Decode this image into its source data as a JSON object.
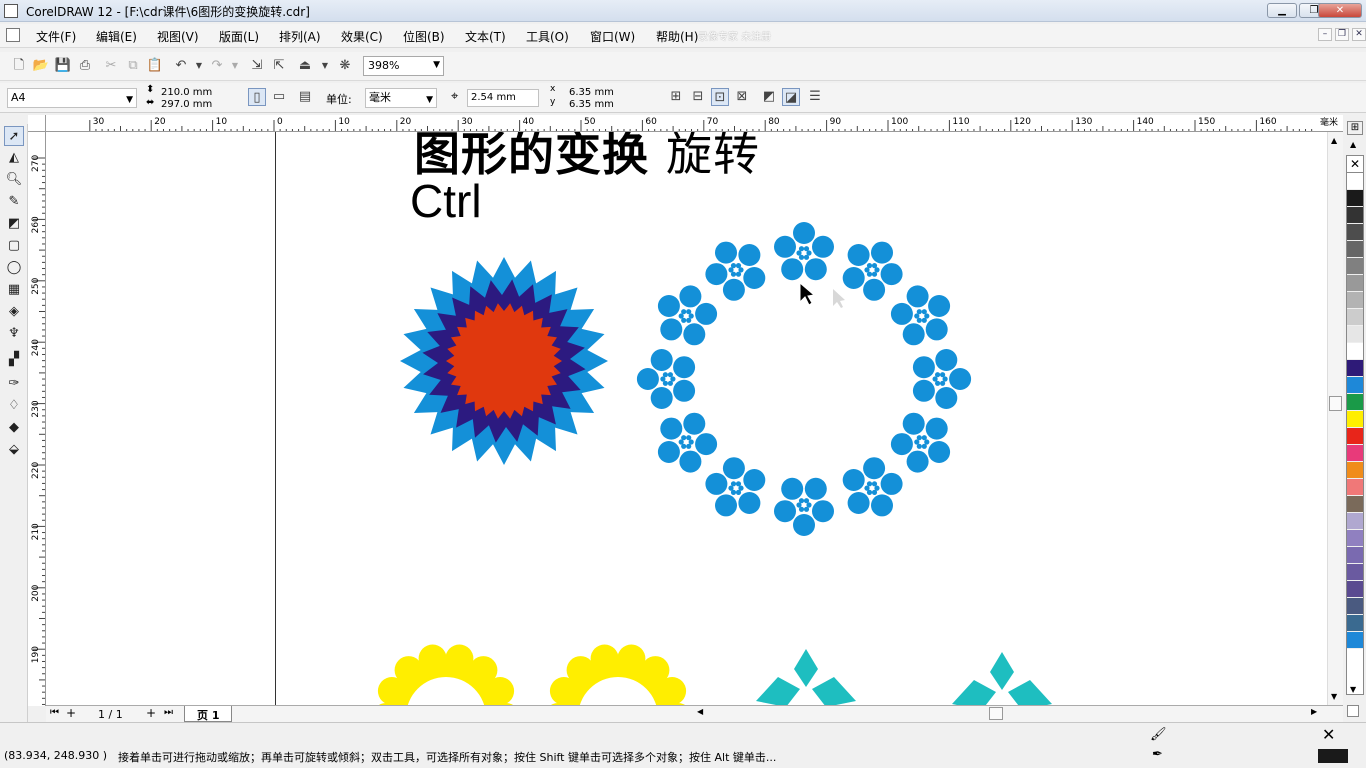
{
  "window": {
    "title": "CorelDRAW 12 - [F:\\cdr课件\\6图形的变换旋转.cdr]",
    "min": "▁",
    "max": "❐",
    "close": "✕"
  },
  "menu": {
    "items": [
      "文件(F)",
      "编辑(E)",
      "视图(V)",
      "版面(L)",
      "排列(A)",
      "效果(C)",
      "位图(B)",
      "文本(T)",
      "工具(O)",
      "窗口(W)",
      "帮助(H)"
    ],
    "overlay": "录像专家 未注册",
    "mdi": [
      "–",
      "❐",
      "✕"
    ]
  },
  "toolbar": {
    "zoom": "398%",
    "dd": "▼"
  },
  "property_bar": {
    "page_size": "A4",
    "width": "210.0 mm",
    "height": "297.0 mm",
    "unit_label": "单位:",
    "unit": "毫米",
    "nudge": "2.54 mm",
    "dup_x_label": "x",
    "dup_y_label": "y",
    "dup_x": "6.35 mm",
    "dup_y": "6.35 mm"
  },
  "ruler": {
    "h_ticks": [
      "30",
      "20",
      "10",
      "0",
      "10",
      "20",
      "30",
      "40",
      "50",
      "60",
      "70",
      "80",
      "90",
      "100",
      "110",
      "120",
      "130",
      "140",
      "150",
      "160"
    ],
    "h_unit": "毫米",
    "v_ticks": [
      "270",
      "260",
      "250",
      "240",
      "230",
      "220",
      "210",
      "200",
      "190"
    ]
  },
  "canvas": {
    "heading_bold": "图形的变换",
    "heading_light": "旋转",
    "subheading": "Ctrl"
  },
  "page_nav": {
    "count": "1 / 1",
    "tab": "页 1"
  },
  "status": {
    "coords": "(83.934, 248.930 )",
    "hint": "接着单击可进行拖动或缩放；再单击可旋转或倾斜；双击工具，可选择所有对象；按住 Shift 键单击可选择多个对象；按住 Alt 键单击..."
  },
  "palette": [
    "#ffffff",
    "#1a1a1a",
    "#333333",
    "#4d4d4d",
    "#666666",
    "#808080",
    "#999999",
    "#b3b3b3",
    "#cccccc",
    "#e6e6e6",
    "#ffffff",
    "#2e1a78",
    "#1e88d8",
    "#1a9a48",
    "#ffee00",
    "#e8251a",
    "#e83a7a",
    "#f08c1a",
    "#f07878",
    "#7a6a5a",
    "#b0a8d0",
    "#9080c0",
    "#7a6ab0",
    "#6a5aa0",
    "#5a4a90",
    "#4a5a80",
    "#3a6a90",
    "#1e88d8"
  ],
  "colors": {
    "blue": "#1490d8",
    "navy": "#2c1a80",
    "red": "#e0380e",
    "yellow": "#ffee00",
    "teal": "#1ebec0"
  }
}
